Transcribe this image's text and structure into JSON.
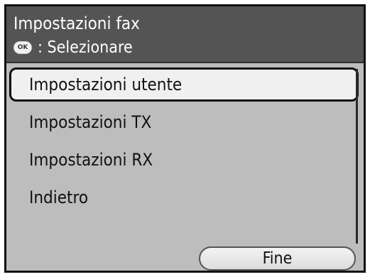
{
  "header": {
    "title": "Impostazioni fax",
    "hint_icon": "ok-button-icon",
    "hint_icon_label": "OK",
    "hint_text": ": Selezionare"
  },
  "menu": {
    "items": [
      {
        "label": "Impostazioni utente",
        "selected": true
      },
      {
        "label": "Impostazioni TX",
        "selected": false
      },
      {
        "label": "Impostazioni RX",
        "selected": false
      },
      {
        "label": "Indietro",
        "selected": false
      }
    ]
  },
  "footer": {
    "done_label": "Fine"
  },
  "colors": {
    "header_bg": "#545454",
    "body_bg": "#bdbdbd",
    "selection_bg": "#f0f0f0",
    "border": "#111111"
  }
}
